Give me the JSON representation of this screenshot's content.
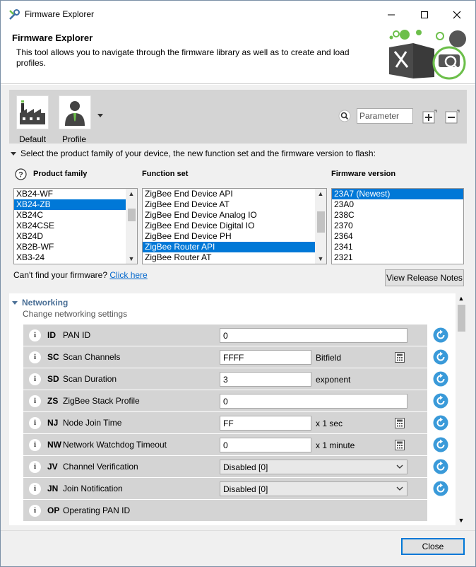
{
  "window": {
    "title": "Firmware Explorer"
  },
  "header": {
    "title": "Firmware Explorer",
    "description": "This tool allows you to navigate through the firmware library as well as to create and load profiles."
  },
  "toolbar": {
    "default_label": "Default",
    "profile_label": "Profile",
    "search_placeholder": "Parameter"
  },
  "selection": {
    "instruction": "Select the product family of your device, the new function set and the firmware version to flash:",
    "product_family": {
      "header": "Product family",
      "items": [
        "XB24-WF",
        "XB24-ZB",
        "XB24C",
        "XB24CSE",
        "XB24D",
        "XB2B-WF",
        "XB3-24"
      ],
      "selected_index": 1
    },
    "function_set": {
      "header": "Function set",
      "items": [
        "ZigBee End Device API",
        "ZigBee End Device AT",
        "ZigBee End Device Analog IO",
        "ZigBee End Device Digital IO",
        "ZigBee End Device PH",
        "ZigBee Router API",
        "ZigBee Router AT"
      ],
      "selected_index": 5
    },
    "firmware_version": {
      "header": "Firmware version",
      "items": [
        "23A7 (Newest)",
        "23A0",
        "238C",
        "2370",
        "2364",
        "2341",
        "2321"
      ],
      "selected_index": 0
    },
    "cant_find_text": "Can't find your firmware?",
    "click_here": "Click here",
    "release_notes_button": "View Release Notes"
  },
  "networking": {
    "title": "Networking",
    "subtitle": "Change networking settings",
    "rows": [
      {
        "code": "ID",
        "label": "PAN ID",
        "type": "text",
        "value": "0",
        "unit": ""
      },
      {
        "code": "SC",
        "label": "Scan Channels",
        "type": "text-short",
        "value": "FFFF",
        "unit": "Bitfield"
      },
      {
        "code": "SD",
        "label": "Scan Duration",
        "type": "text-short",
        "value": "3",
        "unit": "exponent"
      },
      {
        "code": "ZS",
        "label": "ZigBee Stack Profile",
        "type": "text",
        "value": "0",
        "unit": ""
      },
      {
        "code": "NJ",
        "label": "Node Join Time",
        "type": "text-short",
        "value": "FF",
        "unit": "x 1 sec"
      },
      {
        "code": "NW",
        "label": "Network Watchdog Timeout",
        "type": "text-short",
        "value": "0",
        "unit": "x 1 minute"
      },
      {
        "code": "JV",
        "label": "Channel Verification",
        "type": "select",
        "value": "Disabled [0]",
        "unit": ""
      },
      {
        "code": "JN",
        "label": "Join Notification",
        "type": "select",
        "value": "Disabled [0]",
        "unit": ""
      },
      {
        "code": "OP",
        "label": "Operating PAN ID",
        "type": "readonly",
        "value": "",
        "unit": ""
      }
    ]
  },
  "footer": {
    "close_label": "Close"
  },
  "colors": {
    "accent": "#0078d7",
    "refresh": "#3a9ad9",
    "green": "#6cbf4a",
    "section_title": "#4a6f96"
  }
}
